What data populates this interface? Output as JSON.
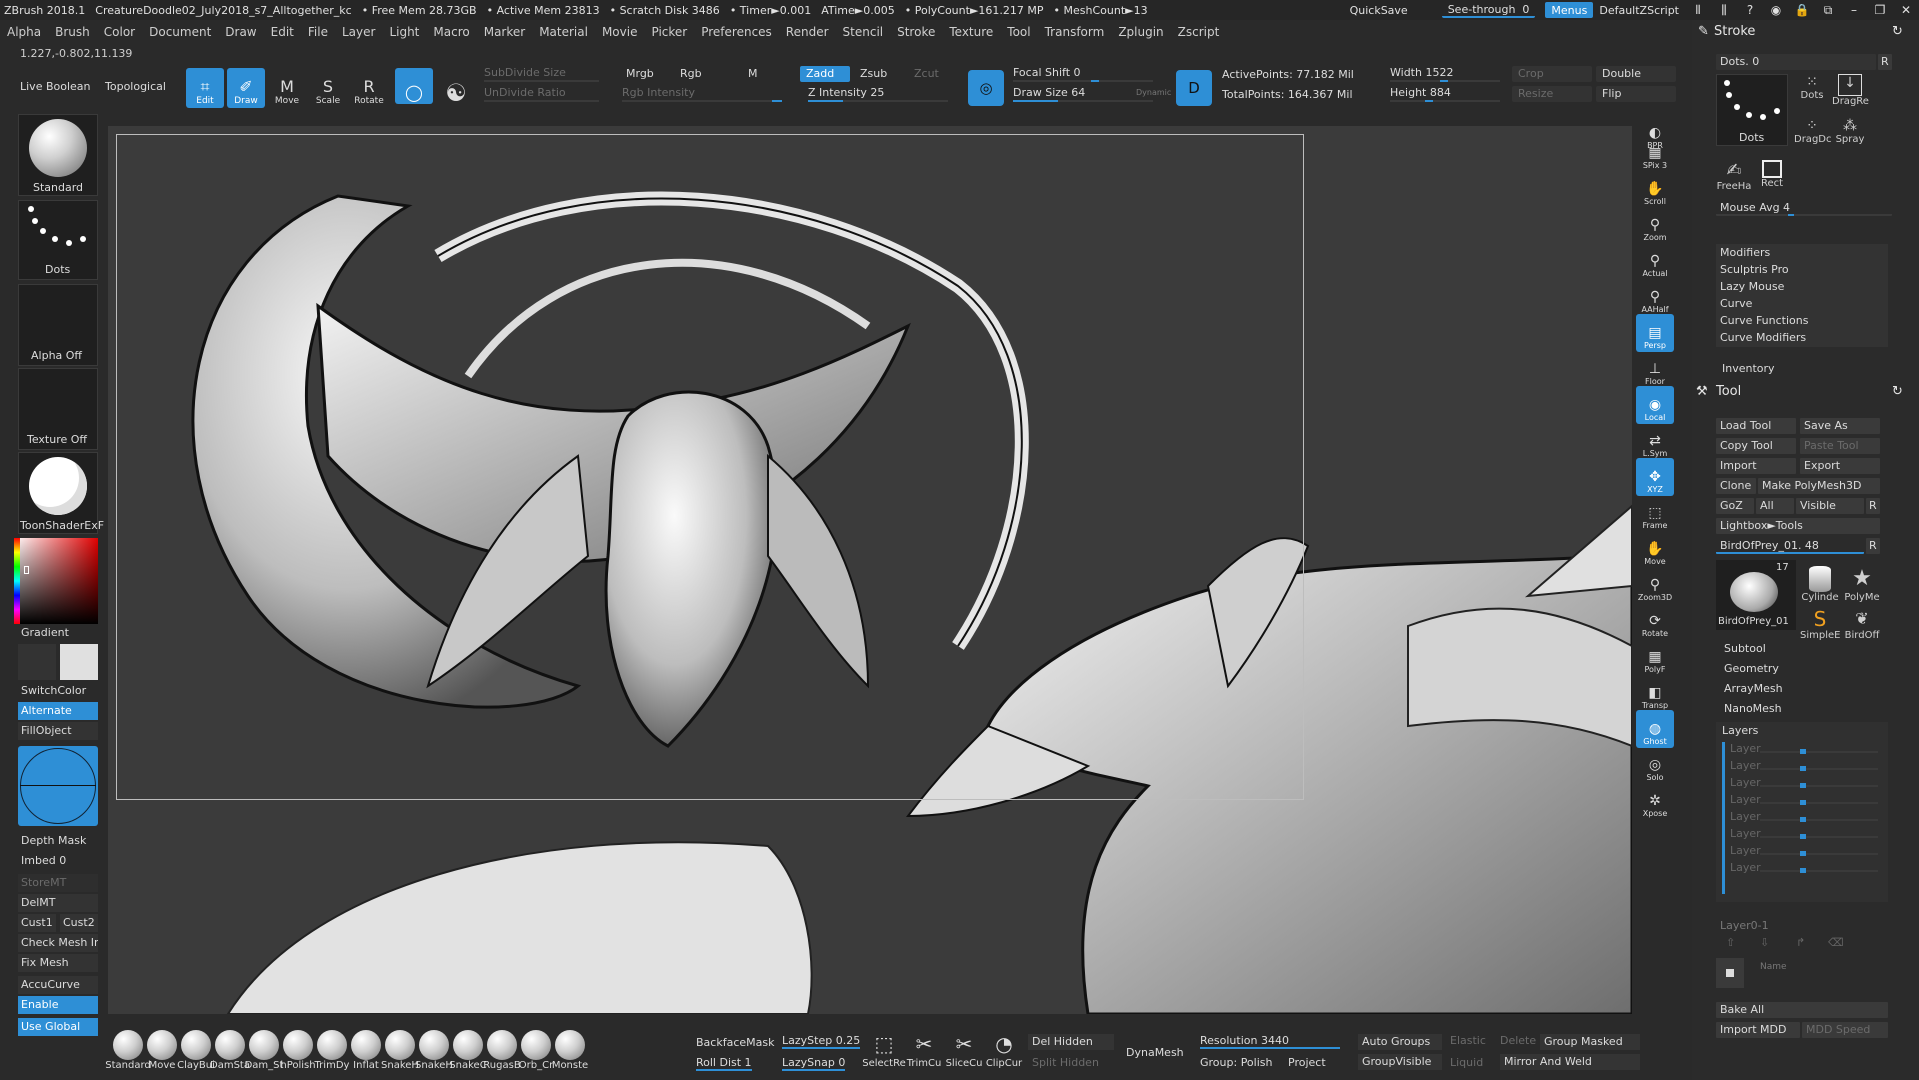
{
  "titlebar": {
    "app": "ZBrush 2018.1",
    "doc": "CreatureDoodle02_July2018_s7_Alltogether_kc",
    "stats": [
      "• Free Mem 28.73GB",
      "• Active Mem 23813",
      "• Scratch Disk 3486",
      "• Timer►0.001",
      "ATime►0.005",
      "• PolyCount►161.217 MP",
      "• MeshCount►13"
    ],
    "quicksave": "QuickSave",
    "see_through": "See-through",
    "see_through_value": "0",
    "menus": "Menus",
    "default_script": "DefaultZScript"
  },
  "menubar": [
    "Alpha",
    "Brush",
    "Color",
    "Document",
    "Draw",
    "Edit",
    "File",
    "Layer",
    "Light",
    "Macro",
    "Marker",
    "Material",
    "Movie",
    "Picker",
    "Preferences",
    "Render",
    "Stencil",
    "Stroke",
    "Texture",
    "Tool",
    "Transform",
    "Zplugin",
    "Zscript"
  ],
  "coords": "1.227,-0.802,11.139",
  "shelf": {
    "live_boolean": "Live Boolean",
    "topological": "Topological",
    "edit": "Edit",
    "draw": "Draw",
    "move": "Move",
    "scale": "Scale",
    "rotate": "Rotate",
    "subdivide_size": "SubDivide Size",
    "undivide_ratio": "UnDivide Ratio",
    "mrgb": "Mrgb",
    "rgb": "Rgb",
    "m": "M",
    "rgb_intensity": "Rgb Intensity",
    "zadd": "Zadd",
    "zsub": "Zsub",
    "zcut": "Zcut",
    "z_intensity": "Z Intensity 25",
    "z_intensity_value": 25,
    "focal_shift": "Focal Shift 0",
    "draw_size": "Draw Size 64",
    "draw_size_value": 64,
    "dynamic": "Dynamic",
    "active_points": "ActivePoints: 77.182 Mil",
    "total_points": "TotalPoints: 164.367 Mil",
    "width": "Width 1522",
    "height": "Height 884",
    "crop": "Crop",
    "resize": "Resize",
    "double": "Double",
    "flip": "Flip"
  },
  "left_palette": {
    "brush": "Standard",
    "stroke": "Dots",
    "alpha": "Alpha Off",
    "texture": "Texture Off",
    "material": "ToonShaderExF",
    "gradient": "Gradient",
    "switch_color": "SwitchColor",
    "alternate": "Alternate",
    "fill_object": "FillObject",
    "depth_mask": "Depth Mask",
    "imbed": "Imbed 0",
    "store_mt": "StoreMT",
    "del_mt": "DelMT",
    "cust1": "Cust1",
    "cust2": "Cust2",
    "check_mesh": "Check Mesh In",
    "fix_mesh": "Fix Mesh",
    "accucurve": "AccuCurve",
    "enable": "Enable",
    "use_global": "Use Global"
  },
  "right_toolbar": [
    "BPR",
    "SPix 3",
    "Scroll",
    "Zoom",
    "Actual",
    "AAHalf",
    "Persp",
    "Floor",
    "Local",
    "L.Sym",
    "XYZ",
    "Frame",
    "Move",
    "Zoom3D",
    "Rotate",
    "PolyF",
    "Transp",
    "Ghost",
    "Solo",
    "Xpose"
  ],
  "right_panel": {
    "stroke_title": "Stroke",
    "dots_field": "Dots. 0",
    "stroke_types": [
      "Dots",
      "DragRe",
      "DragDc",
      "Spray",
      "FreeHa",
      "Rect"
    ],
    "mouse_avg": "Mouse Avg 4",
    "stroke_items": [
      "Modifiers",
      "Sculptris Pro",
      "Lazy Mouse",
      "Curve",
      "Curve Functions",
      "Curve Modifiers"
    ],
    "inventory": "Inventory",
    "tool_title": "Tool",
    "load_tool": "Load Tool",
    "save_as": "Save As",
    "copy_tool": "Copy Tool",
    "paste_tool": "Paste Tool",
    "import": "Import",
    "export": "Export",
    "clone": "Clone",
    "make_polymesh": "Make PolyMesh3D",
    "goz": "GoZ",
    "all": "All",
    "visible": "Visible",
    "r": "R",
    "lightbox_tools": "Lightbox►Tools",
    "current_tool": "BirdOfPrey_01. 48",
    "tool_count": "17",
    "tool_thumbs": [
      "BirdOfPrey_01",
      "Cylinde",
      "PolyMe",
      "SimpleE",
      "BirdOff"
    ],
    "tool_items": [
      "Subtool",
      "Geometry",
      "ArrayMesh",
      "NanoMesh"
    ],
    "layers_title": "Layers",
    "layer_label": "Layer",
    "layer_count": 8,
    "layer_name_field": "Layer0-1",
    "name_label": "Name",
    "bake_all": "Bake All",
    "import_mdd": "Import MDD",
    "mdd_speed": "MDD Speed"
  },
  "bottom_shelf": {
    "brushes": [
      "Standard",
      "Move",
      "ClayBui",
      "DamSta",
      "Dam_St",
      "hPolish",
      "TrimDy",
      "Inflat",
      "SnakeH",
      "SnakeH",
      "SnakeC",
      "RugasB",
      "Orb_Cr",
      "Monste"
    ],
    "backface_mask": "BackfaceMask",
    "roll_dist": "Roll Dist 1",
    "lazystep": "LazyStep 0.25",
    "lazysnap": "LazySnap 0",
    "select_tools": [
      "SelectRe",
      "TrimCu",
      "SliceCu",
      "ClipCur"
    ],
    "del_hidden": "Del Hidden",
    "split_hidden": "Split Hidden",
    "dynamesh": "DynaMesh",
    "resolution": "Resolution 3440",
    "group_polish": "Group: Polish",
    "project": "Project",
    "auto_groups": "Auto Groups",
    "group_visible": "GroupVisible",
    "elastic": "Elastic",
    "liquid": "Liquid",
    "delete": "Delete",
    "group_masked": "Group Masked",
    "mirror_and_weld": "Mirror And Weld"
  },
  "colors": {
    "accent": "#2e8fd6",
    "background": "#2a2a2a",
    "canvas": "#3b3b3b"
  }
}
